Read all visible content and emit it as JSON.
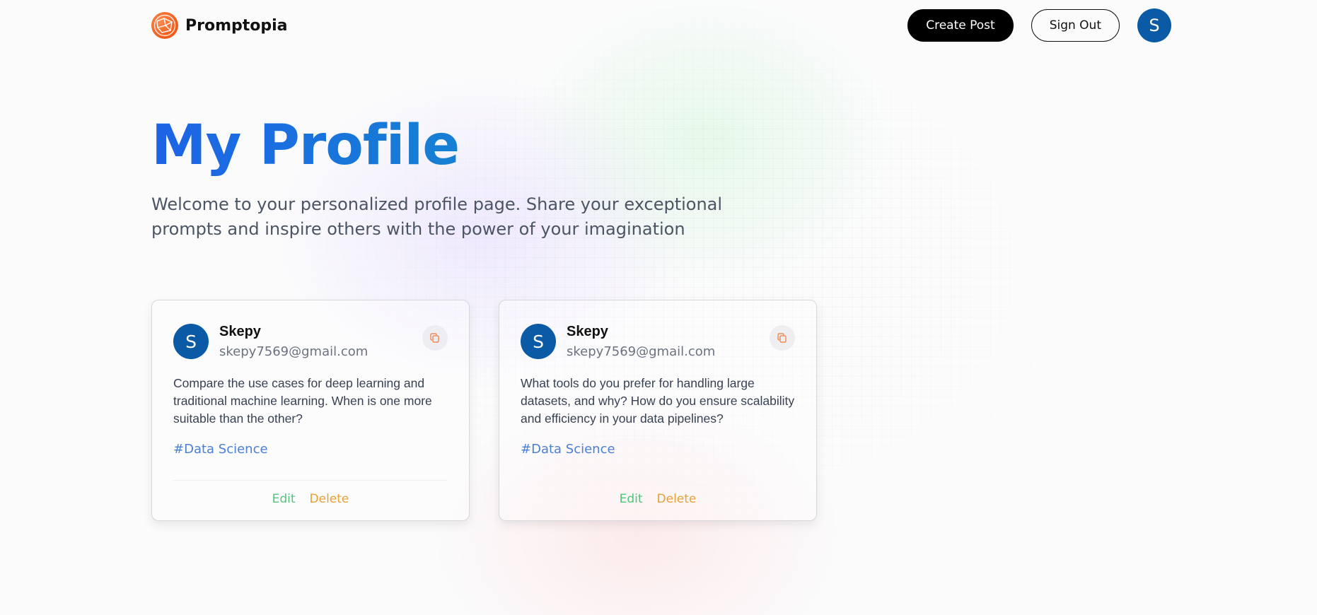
{
  "header": {
    "brand": "Promptopia",
    "create_post": "Create Post",
    "sign_out": "Sign Out",
    "avatar_initial": "S"
  },
  "hero": {
    "title": "My Profile",
    "description": "Welcome to your personalized profile page. Share your exceptional prompts and inspire others with the power of your imagination"
  },
  "posts": [
    {
      "avatar_initial": "S",
      "name": "Skepy",
      "email": "skepy7569@gmail.com",
      "prompt": "Compare the use cases for deep learning and traditional machine learning. When is one more suitable than the other?",
      "tag": "#Data Science",
      "edit": "Edit",
      "delete": "Delete"
    },
    {
      "avatar_initial": "S",
      "name": "Skepy",
      "email": "skepy7569@gmail.com",
      "prompt": "What tools do you prefer for handling large datasets, and why? How do you ensure scalability and efficiency in your data pipelines?",
      "tag": "#Data Science",
      "edit": "Edit",
      "delete": "Delete"
    }
  ],
  "icons": {
    "logo": "globe-network-icon",
    "copy": "copy-icon"
  },
  "colors": {
    "accent_gradient_start": "#1d63e6",
    "accent_gradient_end": "#0f9ec0",
    "avatar_bg": "#0b5aa5",
    "logo_orange": "#f05a1a",
    "edit_green": "#52c47a",
    "delete_orange": "#e7a036",
    "tag_blue": "#4a7fd6"
  }
}
